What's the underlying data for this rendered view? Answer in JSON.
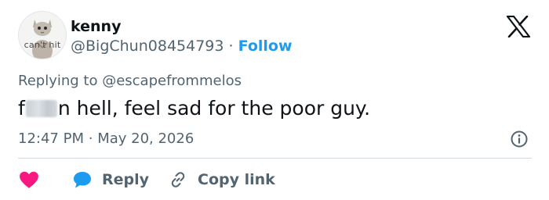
{
  "author": {
    "display_name": "kenny",
    "handle": "@BigChun08454793",
    "separator": "·",
    "follow_label": "Follow",
    "avatar_caption": "can't hit"
  },
  "reply": {
    "prefix": "Replying to ",
    "target": "@escapefrommelos"
  },
  "tweet": {
    "text_start": "f",
    "text_rest": "n hell, feel sad for the poor guy."
  },
  "meta": {
    "time": "12:47 PM",
    "separator": "·",
    "date": "May 20, 2026"
  },
  "actions": {
    "reply_label": "Reply",
    "copy_link_label": "Copy link"
  },
  "colors": {
    "accent": "#1d9bf0",
    "like": "#f91880",
    "muted": "#536471",
    "text": "#0f1419"
  },
  "icons": [
    "x-logo-icon",
    "info-icon",
    "heart-icon",
    "reply-bubble-icon",
    "link-icon"
  ]
}
